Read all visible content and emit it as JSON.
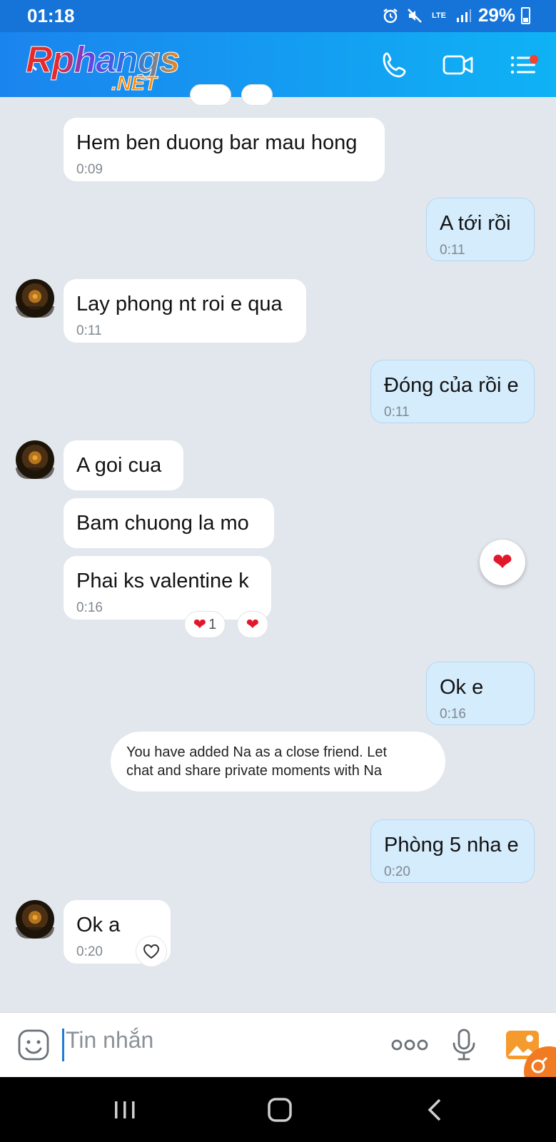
{
  "status_bar": {
    "time": "01:18",
    "network": "LTE",
    "battery": "29%",
    "icons": [
      "alarm-icon",
      "mute-icon",
      "lte-icon",
      "signal-icon",
      "battery-icon"
    ]
  },
  "header": {
    "watermark_main": "Rphangs",
    "watermark_sub": ".NET",
    "actions": [
      "call-icon",
      "video-call-icon",
      "menu-icon"
    ]
  },
  "messages": [
    {
      "side": "in",
      "text": "Hem ben duong bar mau hong",
      "time": "0:09"
    },
    {
      "side": "out",
      "text": "A tới rồi",
      "time": "0:11"
    },
    {
      "side": "in",
      "text": "Lay phong nt roi e qua",
      "time": "0:11"
    },
    {
      "side": "out",
      "text": "Đóng của rồi e",
      "time": "0:11"
    },
    {
      "side": "in",
      "text": "A goi cua",
      "time": ""
    },
    {
      "side": "in",
      "text": "Bam chuong la mo",
      "time": ""
    },
    {
      "side": "in",
      "text": "Phai ks valentine k",
      "time": "0:16",
      "reaction_count": "1"
    },
    {
      "side": "out",
      "text": "Ok e",
      "time": "0:16"
    },
    {
      "side": "out",
      "text": "Phòng 5 nha e",
      "time": "0:20"
    },
    {
      "side": "in",
      "text": "Ok a",
      "time": "0:20"
    }
  ],
  "system_message": {
    "line1": "You have added Na as a close friend. Let",
    "line2": "chat and share private moments with Na"
  },
  "input": {
    "placeholder": "Tin nhắn"
  },
  "colors": {
    "header_start": "#1a84ee",
    "header_end": "#0fb2f5",
    "outgoing_bubble": "#d5ecfc",
    "incoming_bubble": "#ffffff",
    "chat_background": "#e2e6ed",
    "reaction_heart": "#e2182a"
  }
}
